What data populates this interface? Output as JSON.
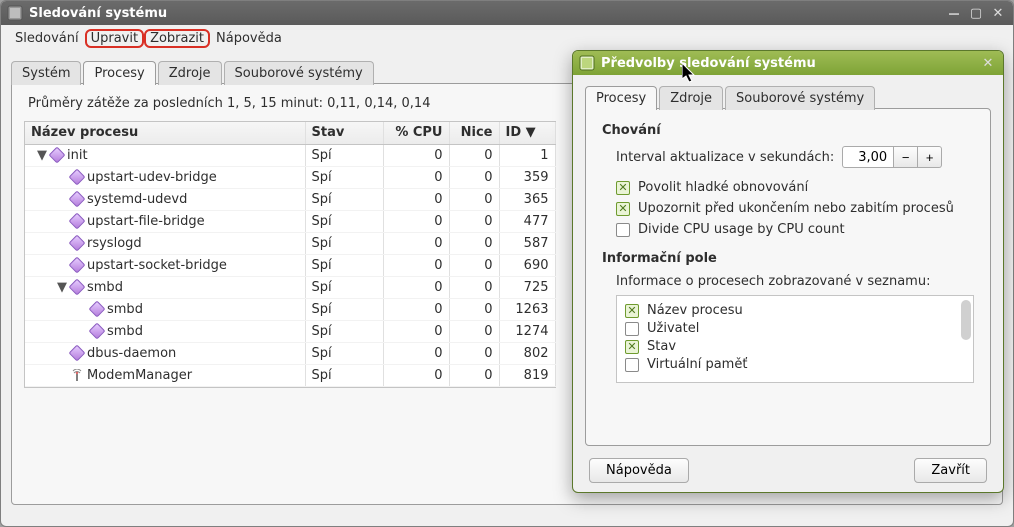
{
  "main": {
    "title": "Sledování systému",
    "menu": {
      "monitor": "Sledování",
      "edit": "Upravit",
      "view": "Zobrazit",
      "help": "Nápověda"
    },
    "tabs": {
      "system": "Systém",
      "processes": "Procesy",
      "resources": "Zdroje",
      "filesystems": "Souborové systémy"
    },
    "loadavg": "Průměry zátěže za posledních 1, 5, 15 minut: 0,11, 0,14, 0,14",
    "columns": {
      "name": "Název procesu",
      "state": "Stav",
      "cpu": "% CPU",
      "nice": "Nice",
      "id": "ID ▼"
    },
    "rows": [
      {
        "indent": 0,
        "twisty": "▼",
        "icon": "diamond",
        "name": "init",
        "state": "Spí",
        "cpu": "0",
        "nice": "0",
        "id": "1"
      },
      {
        "indent": 1,
        "twisty": "",
        "icon": "diamond",
        "name": "upstart-udev-bridge",
        "state": "Spí",
        "cpu": "0",
        "nice": "0",
        "id": "359"
      },
      {
        "indent": 1,
        "twisty": "",
        "icon": "diamond",
        "name": "systemd-udevd",
        "state": "Spí",
        "cpu": "0",
        "nice": "0",
        "id": "365"
      },
      {
        "indent": 1,
        "twisty": "",
        "icon": "diamond",
        "name": "upstart-file-bridge",
        "state": "Spí",
        "cpu": "0",
        "nice": "0",
        "id": "477"
      },
      {
        "indent": 1,
        "twisty": "",
        "icon": "diamond",
        "name": "rsyslogd",
        "state": "Spí",
        "cpu": "0",
        "nice": "0",
        "id": "587"
      },
      {
        "indent": 1,
        "twisty": "",
        "icon": "diamond",
        "name": "upstart-socket-bridge",
        "state": "Spí",
        "cpu": "0",
        "nice": "0",
        "id": "690"
      },
      {
        "indent": 1,
        "twisty": "▼",
        "icon": "diamond",
        "name": "smbd",
        "state": "Spí",
        "cpu": "0",
        "nice": "0",
        "id": "725"
      },
      {
        "indent": 2,
        "twisty": "",
        "icon": "diamond",
        "name": "smbd",
        "state": "Spí",
        "cpu": "0",
        "nice": "0",
        "id": "1263"
      },
      {
        "indent": 2,
        "twisty": "",
        "icon": "diamond",
        "name": "smbd",
        "state": "Spí",
        "cpu": "0",
        "nice": "0",
        "id": "1274"
      },
      {
        "indent": 1,
        "twisty": "",
        "icon": "diamond",
        "name": "dbus-daemon",
        "state": "Spí",
        "cpu": "0",
        "nice": "0",
        "id": "802"
      },
      {
        "indent": 1,
        "twisty": "",
        "icon": "antenna",
        "name": "ModemManager",
        "state": "Spí",
        "cpu": "0",
        "nice": "0",
        "id": "819"
      }
    ]
  },
  "prefs": {
    "title": "Předvolby sledování systému",
    "tabs": {
      "processes": "Procesy",
      "resources": "Zdroje",
      "filesystems": "Souborové systémy"
    },
    "behavior": {
      "heading": "Chování",
      "interval_label": "Interval aktualizace v sekundách:",
      "interval_value": "3,00",
      "smooth": "Povolit hladké obnovování",
      "warn": "Upozornit před ukončením nebo zabitím procesů",
      "divide": "Divide CPU usage by CPU count"
    },
    "infofields": {
      "heading": "Informační pole",
      "desc": "Informace o procesech zobrazované v seznamu:",
      "items": [
        {
          "label": "Název procesu",
          "checked": true
        },
        {
          "label": "Uživatel",
          "checked": false
        },
        {
          "label": "Stav",
          "checked": true
        },
        {
          "label": "Virtuální paměť",
          "checked": false
        }
      ]
    },
    "buttons": {
      "help": "Nápověda",
      "close": "Zavřít"
    }
  }
}
